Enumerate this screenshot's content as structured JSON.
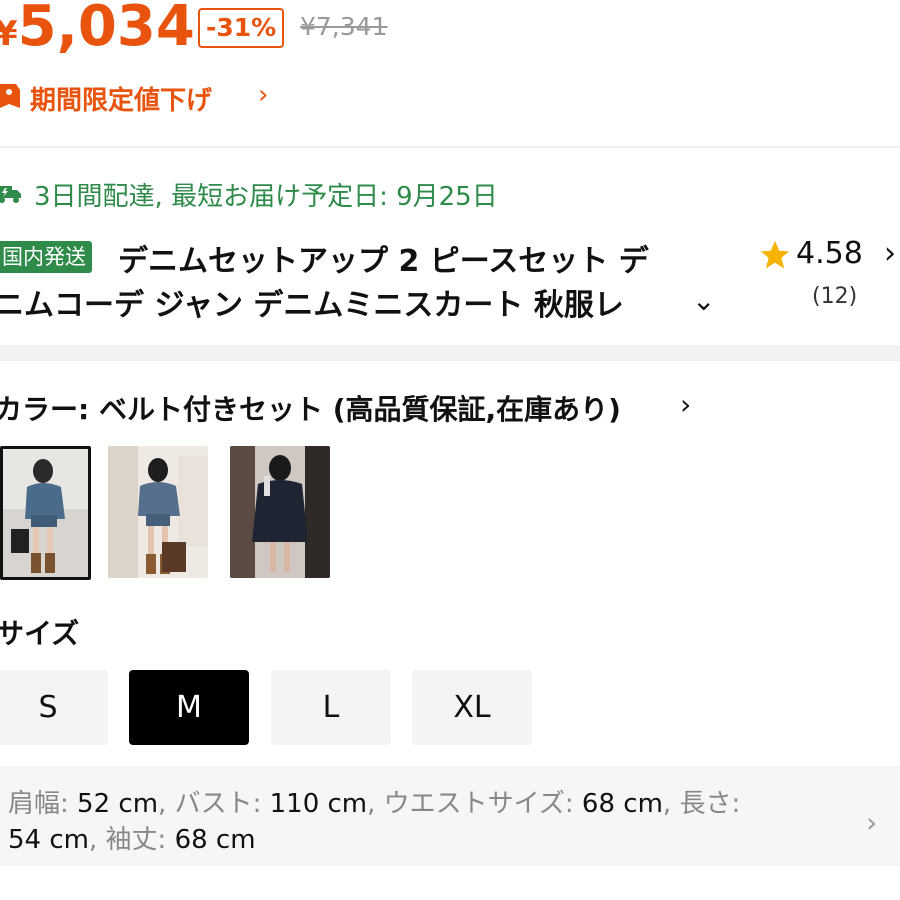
{
  "price": {
    "currency": "¥",
    "value": "5,034",
    "discount": "-31%",
    "original": "¥7,341"
  },
  "promo": {
    "label": "期間限定値下げ",
    "chevron": "›",
    "icon": "tag-icon"
  },
  "delivery": {
    "text": "3日間配達, 最短お届け予定日: 9月25日",
    "icon": "truck-icon"
  },
  "product": {
    "badge": "国内発送",
    "title_line1": "デニムセットアップ 2 ピースセット デ",
    "title_line2": "ニムコーデ ジャン デニムミニスカート 秋服レ",
    "expand": "⌄",
    "rating": "4.58",
    "rating_chevron": "›",
    "review_count": "(12)"
  },
  "color": {
    "label": "カラー: ベルト付きセット (高品質保証,在庫あり)",
    "chevron": "›"
  },
  "size": {
    "label": "サイズ",
    "options": [
      "S",
      "M",
      "L",
      "XL"
    ],
    "selected": "M"
  },
  "size_info": {
    "items": [
      {
        "key": "肩幅",
        "value": "52 cm"
      },
      {
        "key": "バスト",
        "value": "110 cm"
      },
      {
        "key": "ウエストサイズ",
        "value": "68 cm"
      },
      {
        "key": "長さ",
        "value": "54 cm"
      },
      {
        "key": "袖丈",
        "value": "68 cm"
      }
    ],
    "chevron": "›"
  },
  "colors": {
    "accent": "#e8530e",
    "green": "#2e8b4a",
    "star": "#f5b400"
  }
}
